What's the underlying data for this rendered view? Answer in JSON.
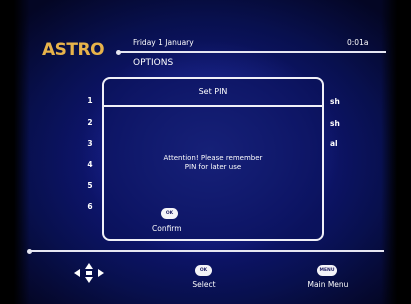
{
  "header": {
    "logo": "ASTRO",
    "date": "Friday 1 January",
    "time": "0:01a",
    "title": "OPTIONS"
  },
  "list": {
    "numbers": [
      "1",
      "2",
      "3",
      "4",
      "5",
      "6"
    ],
    "fragments": [
      "sh",
      "sh",
      "al"
    ]
  },
  "dialog": {
    "title": "Set PIN",
    "message_line1": "Attention! Please remember",
    "message_line2": "PIN for later use",
    "ok_badge": "OK",
    "confirm_label": "Confirm"
  },
  "footer": {
    "nav_icon": "dpad-arrows-icon",
    "ok_badge": "OK",
    "select_label": "Select",
    "menu_badge": "MENU",
    "main_menu_label": "Main Menu"
  },
  "colors": {
    "background": "#0e1570",
    "logo": "#e8b34a",
    "lines": "#e6e6f2",
    "badge": "#f4f4f8"
  }
}
